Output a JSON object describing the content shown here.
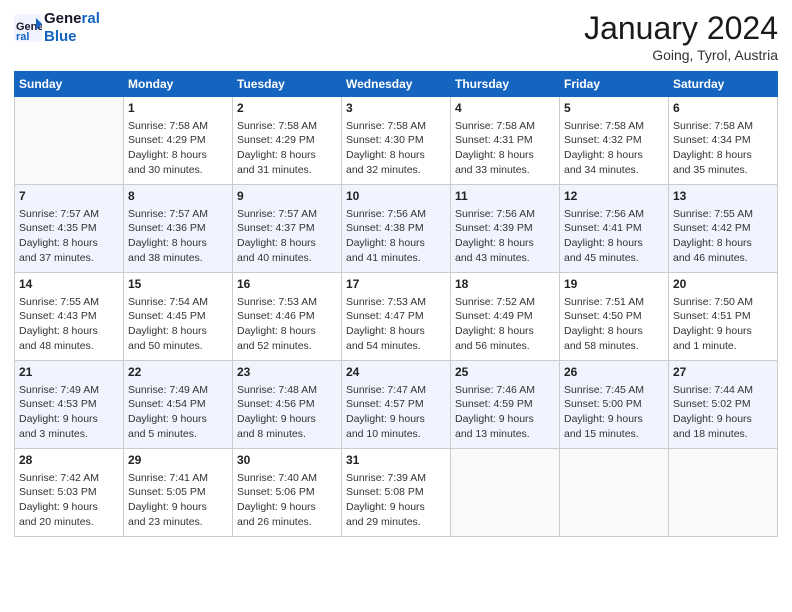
{
  "header": {
    "logo_line1": "General",
    "logo_line2": "Blue",
    "month_title": "January 2024",
    "location": "Going, Tyrol, Austria"
  },
  "weekdays": [
    "Sunday",
    "Monday",
    "Tuesday",
    "Wednesday",
    "Thursday",
    "Friday",
    "Saturday"
  ],
  "weeks": [
    {
      "alt": false,
      "days": [
        {
          "num": "",
          "info": ""
        },
        {
          "num": "1",
          "info": "Sunrise: 7:58 AM\nSunset: 4:29 PM\nDaylight: 8 hours\nand 30 minutes."
        },
        {
          "num": "2",
          "info": "Sunrise: 7:58 AM\nSunset: 4:29 PM\nDaylight: 8 hours\nand 31 minutes."
        },
        {
          "num": "3",
          "info": "Sunrise: 7:58 AM\nSunset: 4:30 PM\nDaylight: 8 hours\nand 32 minutes."
        },
        {
          "num": "4",
          "info": "Sunrise: 7:58 AM\nSunset: 4:31 PM\nDaylight: 8 hours\nand 33 minutes."
        },
        {
          "num": "5",
          "info": "Sunrise: 7:58 AM\nSunset: 4:32 PM\nDaylight: 8 hours\nand 34 minutes."
        },
        {
          "num": "6",
          "info": "Sunrise: 7:58 AM\nSunset: 4:34 PM\nDaylight: 8 hours\nand 35 minutes."
        }
      ]
    },
    {
      "alt": true,
      "days": [
        {
          "num": "7",
          "info": "Sunrise: 7:57 AM\nSunset: 4:35 PM\nDaylight: 8 hours\nand 37 minutes."
        },
        {
          "num": "8",
          "info": "Sunrise: 7:57 AM\nSunset: 4:36 PM\nDaylight: 8 hours\nand 38 minutes."
        },
        {
          "num": "9",
          "info": "Sunrise: 7:57 AM\nSunset: 4:37 PM\nDaylight: 8 hours\nand 40 minutes."
        },
        {
          "num": "10",
          "info": "Sunrise: 7:56 AM\nSunset: 4:38 PM\nDaylight: 8 hours\nand 41 minutes."
        },
        {
          "num": "11",
          "info": "Sunrise: 7:56 AM\nSunset: 4:39 PM\nDaylight: 8 hours\nand 43 minutes."
        },
        {
          "num": "12",
          "info": "Sunrise: 7:56 AM\nSunset: 4:41 PM\nDaylight: 8 hours\nand 45 minutes."
        },
        {
          "num": "13",
          "info": "Sunrise: 7:55 AM\nSunset: 4:42 PM\nDaylight: 8 hours\nand 46 minutes."
        }
      ]
    },
    {
      "alt": false,
      "days": [
        {
          "num": "14",
          "info": "Sunrise: 7:55 AM\nSunset: 4:43 PM\nDaylight: 8 hours\nand 48 minutes."
        },
        {
          "num": "15",
          "info": "Sunrise: 7:54 AM\nSunset: 4:45 PM\nDaylight: 8 hours\nand 50 minutes."
        },
        {
          "num": "16",
          "info": "Sunrise: 7:53 AM\nSunset: 4:46 PM\nDaylight: 8 hours\nand 52 minutes."
        },
        {
          "num": "17",
          "info": "Sunrise: 7:53 AM\nSunset: 4:47 PM\nDaylight: 8 hours\nand 54 minutes."
        },
        {
          "num": "18",
          "info": "Sunrise: 7:52 AM\nSunset: 4:49 PM\nDaylight: 8 hours\nand 56 minutes."
        },
        {
          "num": "19",
          "info": "Sunrise: 7:51 AM\nSunset: 4:50 PM\nDaylight: 8 hours\nand 58 minutes."
        },
        {
          "num": "20",
          "info": "Sunrise: 7:50 AM\nSunset: 4:51 PM\nDaylight: 9 hours\nand 1 minute."
        }
      ]
    },
    {
      "alt": true,
      "days": [
        {
          "num": "21",
          "info": "Sunrise: 7:49 AM\nSunset: 4:53 PM\nDaylight: 9 hours\nand 3 minutes."
        },
        {
          "num": "22",
          "info": "Sunrise: 7:49 AM\nSunset: 4:54 PM\nDaylight: 9 hours\nand 5 minutes."
        },
        {
          "num": "23",
          "info": "Sunrise: 7:48 AM\nSunset: 4:56 PM\nDaylight: 9 hours\nand 8 minutes."
        },
        {
          "num": "24",
          "info": "Sunrise: 7:47 AM\nSunset: 4:57 PM\nDaylight: 9 hours\nand 10 minutes."
        },
        {
          "num": "25",
          "info": "Sunrise: 7:46 AM\nSunset: 4:59 PM\nDaylight: 9 hours\nand 13 minutes."
        },
        {
          "num": "26",
          "info": "Sunrise: 7:45 AM\nSunset: 5:00 PM\nDaylight: 9 hours\nand 15 minutes."
        },
        {
          "num": "27",
          "info": "Sunrise: 7:44 AM\nSunset: 5:02 PM\nDaylight: 9 hours\nand 18 minutes."
        }
      ]
    },
    {
      "alt": false,
      "days": [
        {
          "num": "28",
          "info": "Sunrise: 7:42 AM\nSunset: 5:03 PM\nDaylight: 9 hours\nand 20 minutes."
        },
        {
          "num": "29",
          "info": "Sunrise: 7:41 AM\nSunset: 5:05 PM\nDaylight: 9 hours\nand 23 minutes."
        },
        {
          "num": "30",
          "info": "Sunrise: 7:40 AM\nSunset: 5:06 PM\nDaylight: 9 hours\nand 26 minutes."
        },
        {
          "num": "31",
          "info": "Sunrise: 7:39 AM\nSunset: 5:08 PM\nDaylight: 9 hours\nand 29 minutes."
        },
        {
          "num": "",
          "info": ""
        },
        {
          "num": "",
          "info": ""
        },
        {
          "num": "",
          "info": ""
        }
      ]
    }
  ]
}
